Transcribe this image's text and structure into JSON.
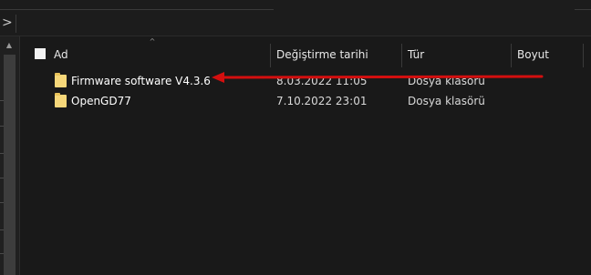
{
  "nav": {
    "back_arrow": ">",
    "scroll_up_arrow": "▲"
  },
  "columns": {
    "sort_indicator": "^",
    "name": "Ad",
    "date_modified": "Değiştirme tarihi",
    "type": "Tür",
    "size": "Boyut"
  },
  "files": [
    {
      "name": "Firmware software V4.3.6",
      "date": "8.03.2022 11:05",
      "type": "Dosya klasörü",
      "icon": "folder-icon"
    },
    {
      "name": "OpenGD77",
      "date": "7.10.2022 23:01",
      "type": "Dosya klasörü",
      "icon": "folder-icon"
    }
  ],
  "annotation": {
    "color": "#d40f0f",
    "kind": "red-arrow-pointing-left"
  },
  "colors": {
    "background": "#191919",
    "folder": "#f6d77a",
    "text": "#ffffff"
  }
}
